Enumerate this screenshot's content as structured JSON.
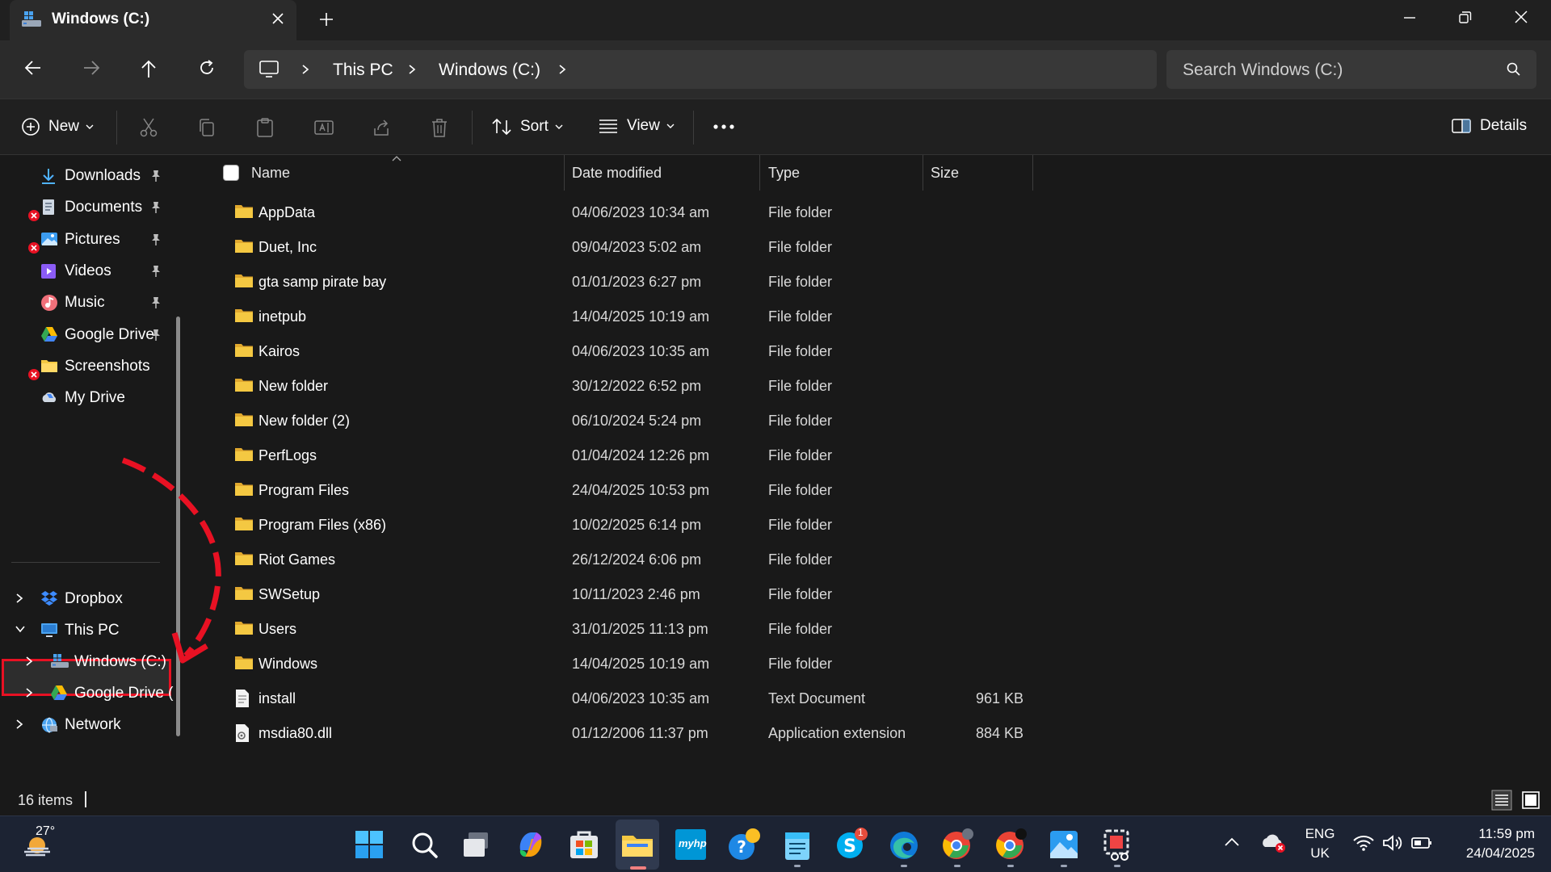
{
  "window": {
    "tab_title": "Windows (C:)",
    "tab_icon": "drive-icon"
  },
  "nav": {
    "breadcrumbs": [
      "This PC",
      "Windows (C:)"
    ],
    "search_placeholder": "Search Windows (C:)"
  },
  "commands": {
    "new_label": "New",
    "sort_label": "Sort",
    "view_label": "View",
    "details_label": "Details"
  },
  "sidebar": {
    "quick_access": [
      {
        "label": "Downloads",
        "icon": "downloads-icon",
        "pinned": true,
        "error": false
      },
      {
        "label": "Documents",
        "icon": "documents-icon",
        "pinned": true,
        "error": true
      },
      {
        "label": "Pictures",
        "icon": "pictures-icon",
        "pinned": true,
        "error": true
      },
      {
        "label": "Videos",
        "icon": "videos-icon",
        "pinned": true,
        "error": false
      },
      {
        "label": "Music",
        "icon": "music-icon",
        "pinned": true,
        "error": false
      },
      {
        "label": "Google Drive",
        "icon": "google-drive-icon",
        "pinned": true,
        "error": false
      },
      {
        "label": "Screenshots",
        "icon": "folder-icon",
        "pinned": false,
        "error": true
      },
      {
        "label": "My Drive",
        "icon": "my-drive-icon",
        "pinned": false,
        "error": false
      }
    ],
    "tree": [
      {
        "label": "Dropbox",
        "expanded": false
      },
      {
        "label": "This PC",
        "expanded": true
      },
      {
        "label": "Windows (C:)",
        "expanded": false,
        "selected": true
      },
      {
        "label": "Google Drive (",
        "expanded": false
      },
      {
        "label": "Network",
        "expanded": false
      }
    ],
    "highlight_color": "#e81123"
  },
  "columns": {
    "name": "Name",
    "date": "Date modified",
    "type": "Type",
    "size": "Size"
  },
  "files": [
    {
      "name": "AppData",
      "date": "04/06/2023 10:34 am",
      "type": "File folder",
      "size": "",
      "kind": "folder"
    },
    {
      "name": "Duet, Inc",
      "date": "09/04/2023 5:02 am",
      "type": "File folder",
      "size": "",
      "kind": "folder"
    },
    {
      "name": "gta samp pirate bay",
      "date": "01/01/2023 6:27 pm",
      "type": "File folder",
      "size": "",
      "kind": "folder"
    },
    {
      "name": "inetpub",
      "date": "14/04/2025 10:19 am",
      "type": "File folder",
      "size": "",
      "kind": "folder"
    },
    {
      "name": "Kairos",
      "date": "04/06/2023 10:35 am",
      "type": "File folder",
      "size": "",
      "kind": "folder"
    },
    {
      "name": "New folder",
      "date": "30/12/2022 6:52 pm",
      "type": "File folder",
      "size": "",
      "kind": "folder"
    },
    {
      "name": "New folder (2)",
      "date": "06/10/2024 5:24 pm",
      "type": "File folder",
      "size": "",
      "kind": "folder"
    },
    {
      "name": "PerfLogs",
      "date": "01/04/2024 12:26 pm",
      "type": "File folder",
      "size": "",
      "kind": "folder"
    },
    {
      "name": "Program Files",
      "date": "24/04/2025 10:53 pm",
      "type": "File folder",
      "size": "",
      "kind": "folder"
    },
    {
      "name": "Program Files (x86)",
      "date": "10/02/2025 6:14 pm",
      "type": "File folder",
      "size": "",
      "kind": "folder"
    },
    {
      "name": "Riot Games",
      "date": "26/12/2024 6:06 pm",
      "type": "File folder",
      "size": "",
      "kind": "folder"
    },
    {
      "name": "SWSetup",
      "date": "10/11/2023 2:46 pm",
      "type": "File folder",
      "size": "",
      "kind": "folder"
    },
    {
      "name": "Users",
      "date": "31/01/2025 11:13 pm",
      "type": "File folder",
      "size": "",
      "kind": "folder"
    },
    {
      "name": "Windows",
      "date": "14/04/2025 10:19 am",
      "type": "File folder",
      "size": "",
      "kind": "folder"
    },
    {
      "name": "install",
      "date": "04/06/2023 10:35 am",
      "type": "Text Document",
      "size": "961 KB",
      "kind": "text"
    },
    {
      "name": "msdia80.dll",
      "date": "01/12/2006 11:37 pm",
      "type": "Application extension",
      "size": "884 KB",
      "kind": "dll"
    }
  ],
  "status": {
    "item_count": "16 items"
  },
  "taskbar": {
    "weather_temp": "27°",
    "apps": [
      "start-icon",
      "search-icon",
      "task-view-icon",
      "copilot-icon",
      "store-icon",
      "file-explorer-icon",
      "myhp-icon",
      "tips-icon",
      "notepad-icon",
      "skype-icon",
      "edge-icon",
      "chrome-icon",
      "chrome-profile-icon",
      "photos-icon",
      "snipping-tool-icon"
    ],
    "myhp_text": "myhp",
    "skype_badge": "1",
    "language_line1": "ENG",
    "language_line2": "UK",
    "time": "11:59 pm",
    "date": "24/04/2025"
  },
  "colors": {
    "folder": "#f4c842",
    "accent_arrow": "#e81123"
  }
}
